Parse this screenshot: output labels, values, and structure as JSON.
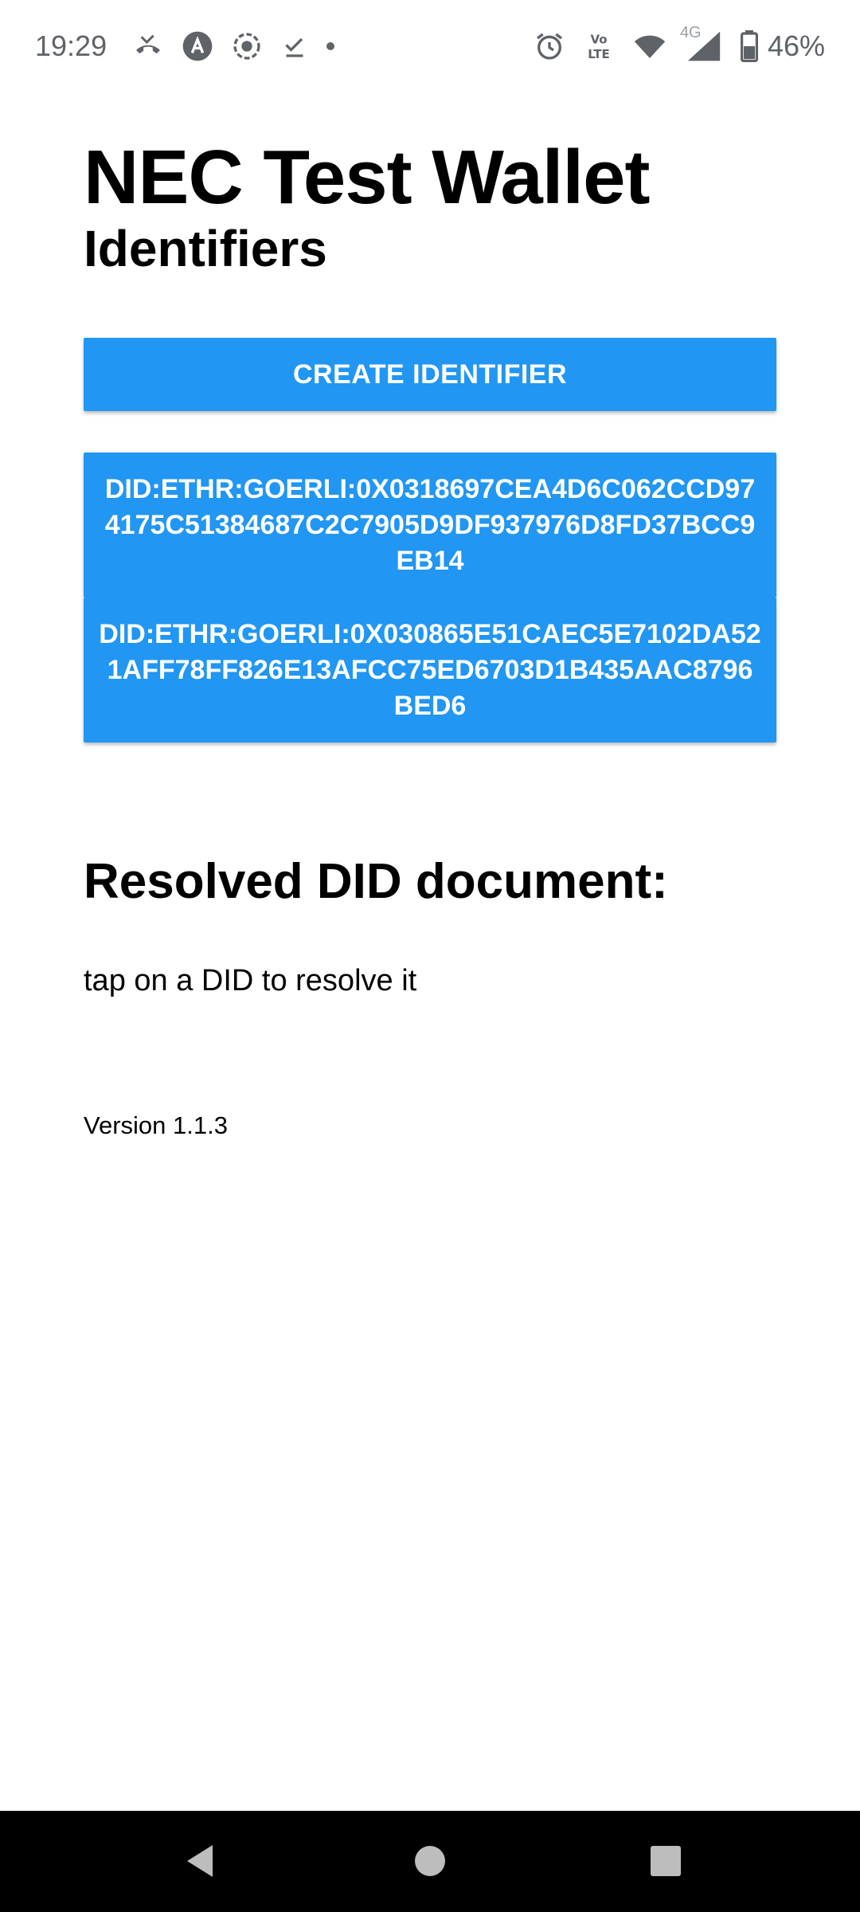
{
  "status_bar": {
    "time": "19:29",
    "left_icons": [
      "missed-call-icon",
      "app-notification-icon",
      "screen-record-icon",
      "download-done-icon",
      "dot-icon"
    ],
    "right_icons": [
      "alarm-icon",
      "volte-icon",
      "wifi-icon",
      "signal-4g-icon",
      "battery-icon"
    ],
    "network_label": "4G",
    "volte_label": "Vo LTE",
    "battery_percent": "46%"
  },
  "header": {
    "app_title": "NEC Test Wallet",
    "section_title": "Identifiers"
  },
  "actions": {
    "create_label": "CREATE IDENTIFIER"
  },
  "identifiers": [
    {
      "label": "DID:ETHR:GOERLI:0X0318697CEA4D6C062CCD974175C51384687C2C7905D9DF937976D8FD37BCC9EB14"
    },
    {
      "label": "DID:ETHR:GOERLI:0X030865E51CAEC5E7102DA521AFF78FF826E13AFCC75ED6703D1B435AAC8796BED6"
    }
  ],
  "resolved": {
    "title": "Resolved DID document:",
    "hint": "tap on a DID to resolve it"
  },
  "footer": {
    "version": "Version 1.1.3"
  },
  "nav_bar": {
    "buttons": [
      "back-icon",
      "home-icon",
      "recents-icon"
    ]
  },
  "colors": {
    "primary": "#2196f3",
    "text": "#000000",
    "status_icons": "#5f6368",
    "nav_bar": "#000000"
  }
}
